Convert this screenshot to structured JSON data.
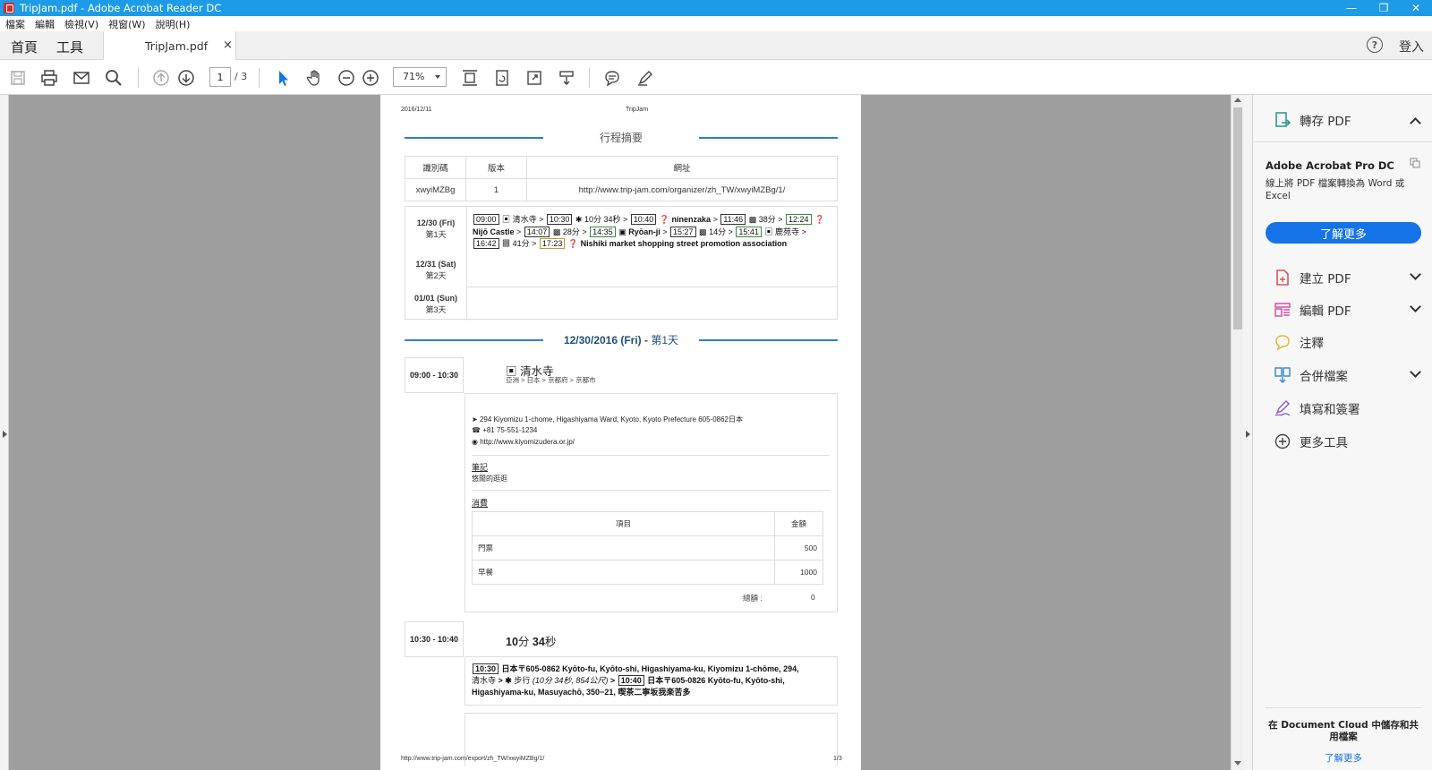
{
  "window": {
    "title": "TripJam.pdf - Adobe Acrobat Reader DC"
  },
  "menu": [
    "檔案",
    "編輯",
    "檢視(V)",
    "視窗(W)",
    "說明(H)"
  ],
  "tabs": {
    "home": "首頁",
    "tools": "工具",
    "doc": "TripJam.pdf",
    "close": "×",
    "login": "登入",
    "help": "?"
  },
  "toolbar": {
    "page_current": "1",
    "page_total": "/ 3",
    "zoom": "71%"
  },
  "page": {
    "header_date": "2016/12/11",
    "header_name": "TripJam",
    "footer_url": "http://www.trip-jam.com/export/zh_TW/xwyiMZBg/1/",
    "footer_page": "1/3",
    "summary_title": "行程摘要",
    "summary_headers": [
      "識別碼",
      "版本",
      "網址"
    ],
    "summary_values": [
      "xwyiMZBg",
      "1",
      "http://www.trip-jam.com/organizer/zh_TW/xwyiMZBg/1/"
    ],
    "days": [
      {
        "date": "12/30 (Fri)",
        "label": "第1天"
      },
      {
        "date": "12/31 (Sat)",
        "label": "第2天"
      },
      {
        "date": "01/01 (Sun)",
        "label": "第3天"
      }
    ],
    "route": {
      "t1": "09:00",
      "p1": "清水寺",
      "t2": "10:30",
      "d1": "10分 34秒",
      "t3": "10:40",
      "p2": "ninenzaka",
      "t4": "11:46",
      "d2": "38分",
      "t5": "12:24",
      "p3": "Nijō Castle",
      "t6": "14:07",
      "d3": "28分",
      "t7": "14:35",
      "p4": "Ryōan-ji",
      "t8": "15:27",
      "d4": "14分",
      "t9": "15:41",
      "p5": "鹿苑寺",
      "t10": "16:42",
      "d5": "41分",
      "t11": "17:23",
      "p6": "Nishiki market shopping street promotion association"
    },
    "day1_title_date": "12/30/2016 (Fri) -",
    "day1_title_day": "第1天",
    "event1": {
      "time": "09:00 - 10:30",
      "title": "清水寺",
      "path": "亞洲 > 日本 > 京都府 > 京都市",
      "address": "294 Kiyomizu 1-chome, Higashiyama Ward, Kyoto, Kyoto Prefecture 605-0862日本",
      "phone": "+81 75-551-1234",
      "web": "http://www.kiyomizudera.or.jp/",
      "notes_label": "筆記",
      "notes": "悠閒的逛逛",
      "cost_label": "消費",
      "cost_headers": [
        "項目",
        "金額"
      ],
      "cost_rows": [
        {
          "item": "門票",
          "amount": "500"
        },
        {
          "item": "早餐",
          "amount": "1000"
        }
      ],
      "total_label": "總額 :",
      "total_value": "0"
    },
    "event2": {
      "time": "10:30 - 10:40",
      "title_num1": "10",
      "title_unit1": "分",
      "title_num2": "34",
      "title_unit2": "秒",
      "t1": "10:30",
      "line1": "日本〒605-0862 Kyōto-fu, Kyōto-shi, Higashiyama-ku, Kiyomizu 1-chōme, 294,",
      "line2_a": "清水寺",
      "line2_b": "步行",
      "line2_c": "(10分 34秒, 854公尺)",
      "t2": "10:40",
      "line2_d": "日本〒605-0826 Kyōto-fu, Kyōto-shi,",
      "line3": "Higashiyama-ku, Masuyachō, 350−21, 喫茶二寧坂我楽苦多"
    }
  },
  "panel": {
    "export": "轉存 PDF",
    "promo_title": "Adobe Acrobat Pro DC",
    "promo_desc": "線上將 PDF 檔案轉換為 Word 或 Excel",
    "promo_btn": "了解更多",
    "create": "建立 PDF",
    "edit": "編輯 PDF",
    "comment": "注釋",
    "combine": "合併檔案",
    "sign": "填寫和簽署",
    "more": "更多工具",
    "dc_text": "在 Document Cloud 中儲存和共用檔案",
    "dc_link": "了解更多"
  },
  "colors": {
    "titlebar": "#1e9be6",
    "accent": "#1473e6",
    "section_line": "#2b7fc8"
  }
}
